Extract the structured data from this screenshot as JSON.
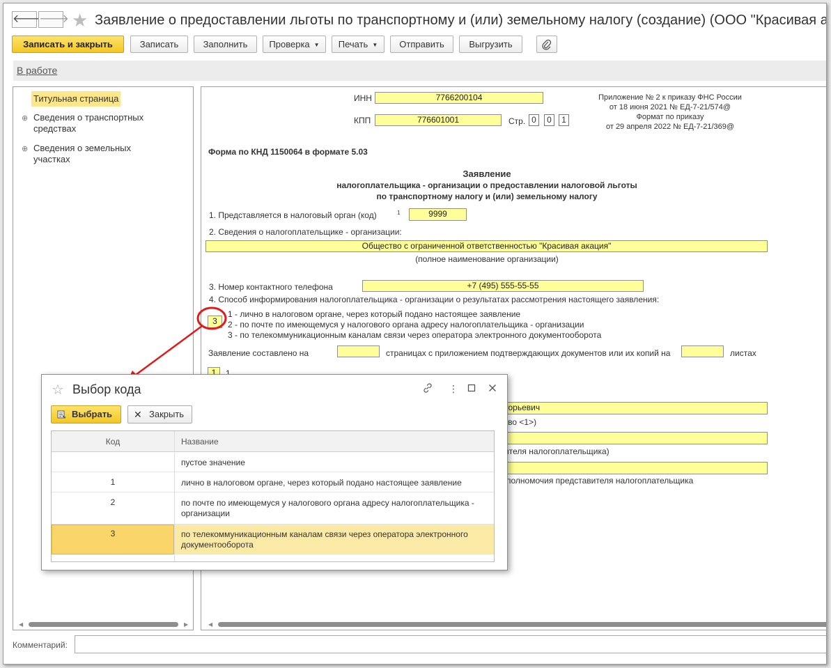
{
  "window": {
    "title": "Заявление о предоставлении льготы по транспортному и (или) земельному налогу (создание) (ООО \"Красивая акация\")"
  },
  "toolbar": {
    "save_close": "Записать и закрыть",
    "save": "Записать",
    "fill": "Заполнить",
    "check": "Проверка",
    "print": "Печать",
    "send": "Отправить",
    "export": "Выгрузить"
  },
  "status": {
    "link": "В работе"
  },
  "nav": {
    "items": [
      {
        "label": "Титульная страница"
      },
      {
        "label": "Сведения о транспортных средствах"
      },
      {
        "label": "Сведения о земельных участках"
      }
    ]
  },
  "form": {
    "inn_label": "ИНН",
    "inn": "7766200104",
    "kpp_label": "КПП",
    "kpp": "776601001",
    "page_label": "Стр.",
    "page_digits": [
      "0",
      "0",
      "1"
    ],
    "order_note": [
      "Приложение № 2 к приказу ФНС России",
      "от 18 июня 2021 № ЕД-7-21/574@",
      "Формат по приказу",
      "от 29 апреля 2022 № ЕД-7-21/369@"
    ],
    "knd": "Форма по КНД 1150064 в формате 5.03",
    "heading": [
      "Заявление",
      "налогоплательщика - организации о предоставлении налоговой льготы",
      "по транспортному налогу и (или) земельному налогу"
    ],
    "q1_label": "1. Представляется в налоговый орган (код)",
    "q1_sup": "1",
    "q1_value": "9999",
    "q2_label": "2. Сведения о налогоплательщике - организации:",
    "org_name": "Общество с ограниченной ответственностью \"Красивая акация\"",
    "org_name_hint": "(полное наименование организации)",
    "q3_label": "3. Номер контактного телефона",
    "phone": "+7 (495) 555-55-55",
    "q4_label": "4. Способ информирования налогоплательщика - организации о результатах рассмотрения настоящего заявления:",
    "q4_value": "3",
    "q4_options": [
      "1 - лично в налоговом органе, через который подано настоящее заявление",
      "2 - по почте по имеющемуся у налогового органа адресу налогоплательщика - организации",
      "3 - по телекоммуникационным каналам связи через оператора электронного документооборота"
    ],
    "pages_prefix": "Заявление составлено на",
    "pages_middle": "страницах с приложением подтверждающих документов или их копий на",
    "pages_suffix": "листах",
    "signer_value": "1",
    "signer_partial": "1",
    "signer_name_partial": "ригорьевич",
    "signer_hint_partial": "ество <1>)",
    "rep_hint_partial": "авителя налогоплательщика)",
    "rep_doc_hint_partial": "полномочия представителя налогоплательщика"
  },
  "comment": {
    "label": "Комментарий:",
    "value": ""
  },
  "dialog": {
    "title": "Выбор кода",
    "select_button": "Выбрать",
    "close_button": "Закрыть",
    "columns": {
      "code": "Код",
      "name": "Название"
    },
    "rows": [
      {
        "code": "",
        "name": "пустое значение"
      },
      {
        "code": "1",
        "name": "лично в налоговом органе, через который подано настоящее заявление"
      },
      {
        "code": "2",
        "name": "по почте по имеющемуся у налогового органа адресу налогоплательщика - организации"
      },
      {
        "code": "3",
        "name": "по телекоммуникационным каналам связи через оператора электронного документооборота"
      }
    ],
    "selected_code": "3"
  },
  "colors": {
    "accent_yellow": "#f4c623",
    "field_yellow": "#ffff99",
    "selected_row": "#fbe9a6",
    "annotation_red": "#e01b1b"
  }
}
